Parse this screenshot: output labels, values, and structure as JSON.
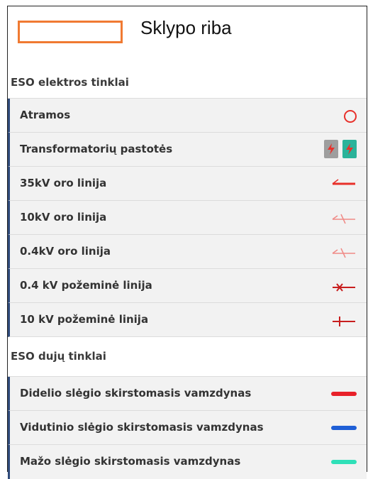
{
  "boundary": {
    "label": "Sklypo riba",
    "color": "#f07a32"
  },
  "electric": {
    "title": "ESO elektros tinklai",
    "items": [
      {
        "label": "Atramos",
        "symbol": "circle-icon"
      },
      {
        "label": "Transformatorių pastotės",
        "symbol": "substation-icons"
      },
      {
        "label": "35kV oro linija",
        "symbol": "line-35kv-icon"
      },
      {
        "label": "10kV oro linija",
        "symbol": "line-10kv-overhead-icon"
      },
      {
        "label": "0.4kV oro linija",
        "symbol": "line-04kv-overhead-icon"
      },
      {
        "label": "0.4 kV požeminė linija",
        "symbol": "line-04kv-underground-icon"
      },
      {
        "label": "10 kV požeminė linija",
        "symbol": "line-10kv-underground-icon"
      }
    ]
  },
  "gas": {
    "title": "ESO dujų tinklai",
    "items": [
      {
        "label": "Didelio slėgio skirstomasis vamzdynas",
        "color": "#e8212a"
      },
      {
        "label": "Vidutinio slėgio skirstomasis vamzdynas",
        "color": "#1f5fd6"
      },
      {
        "label": "Mažo slėgio skirstomasis vamzdynas",
        "color": "#2fe0b8"
      }
    ]
  },
  "colors": {
    "electric_red": "#e8312b",
    "substation_gray": "#9e9e9e",
    "substation_teal": "#2bb39a"
  }
}
